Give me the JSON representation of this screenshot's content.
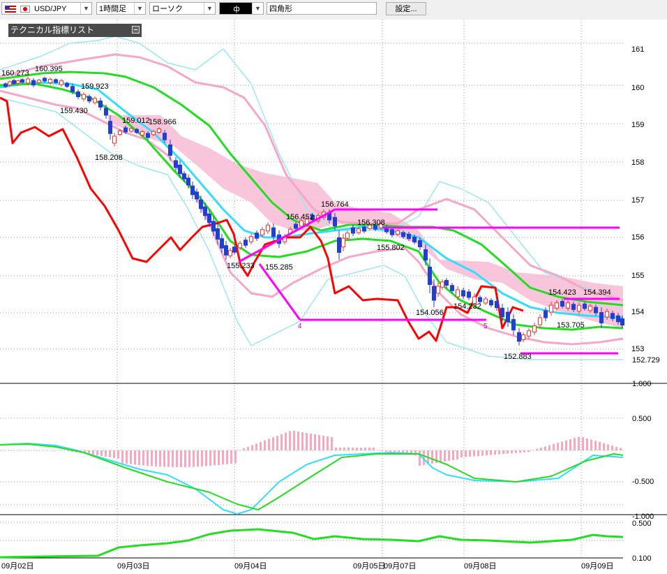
{
  "toolbar": {
    "symbol": "USD/JPY",
    "timeframe": "1時間足",
    "chart_type": "ローソク",
    "drawing_glyph": "ф",
    "drawing_tool": "四角形",
    "settings_button": "設定..."
  },
  "indicator_panel": {
    "label": "テクニカル指標リスト"
  },
  "price_axis": {
    "ticks": [
      "161",
      "160",
      "159",
      "158",
      "157",
      "156",
      "155",
      "154",
      "153"
    ],
    "current_price": "152.729"
  },
  "macd_axis": {
    "ticks": [
      "1.000",
      "0.500",
      "-0.500",
      "-1.000"
    ]
  },
  "adx_axis": {
    "ticks": [
      "0.500",
      "0.100"
    ]
  },
  "time_axis": {
    "labels": [
      "09月02日",
      "09月03日",
      "09月04日",
      "09月05日",
      "09月07日",
      "09月08日",
      "09月09日"
    ]
  },
  "annotations": {
    "prices": [
      "160.273",
      "160.395",
      "159.923",
      "159.430",
      "158.208",
      "159.012",
      "158.966",
      "156.452",
      "156.764",
      "156.308",
      "155.802",
      "155.285",
      "155.233",
      "154.056",
      "154.232",
      "154.423",
      "154.394",
      "153.705",
      "152.883"
    ],
    "wave_labels": [
      "4",
      "5"
    ]
  },
  "colors": {
    "candle_up": "#ff3030",
    "candle_down": "#1f3fd8",
    "lagging_span": "#ff0000",
    "ma_green": "#22dd22",
    "ma_cyan": "#33ddff",
    "cloud": "#f8bfd6",
    "bb_inner": "#f7a6c8",
    "bb_outer": "#9ae8f5",
    "drawing": "#ff00ff"
  }
}
